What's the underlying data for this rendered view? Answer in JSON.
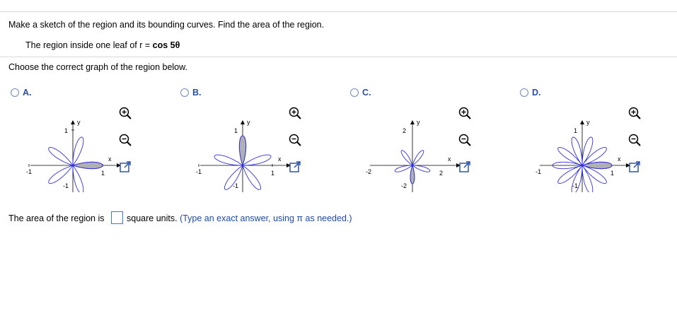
{
  "question": {
    "instruction": "Make a sketch of the region and its bounding curves. Find the area of the region.",
    "region_prefix": "The region inside one leaf of r = ",
    "region_formula": "cos 5θ",
    "choose_prompt": "Choose the correct graph of the region below."
  },
  "options": [
    {
      "letter": "A.",
      "x_label": "x",
      "y_label": "y",
      "y_tick_pos": "1",
      "y_tick_neg": "-1",
      "x_tick_neg": "-1",
      "x_tick_pos": "1"
    },
    {
      "letter": "B.",
      "x_label": "x",
      "y_label": "y",
      "y_tick_pos": "1",
      "y_tick_neg": "-1",
      "x_tick_neg": "-1",
      "x_tick_pos": "1"
    },
    {
      "letter": "C.",
      "x_label": "x",
      "y_label": "y",
      "y_tick_pos": "2",
      "y_tick_neg": "-2",
      "x_tick_neg": "-2",
      "x_tick_pos": "2"
    },
    {
      "letter": "D.",
      "x_label": "x",
      "y_label": "y",
      "y_tick_pos": "1",
      "y_tick_neg": "-1",
      "x_tick_neg": "-1",
      "x_tick_pos": "1"
    }
  ],
  "answer": {
    "prefix": "The area of the region is",
    "suffix": "square units.",
    "hint": "(Type an exact answer, using π as needed.)"
  },
  "colors": {
    "curve": "#3030e0",
    "shade": "#b0b0b0",
    "accent": "#2a4fa0"
  },
  "icons": [
    "zoom-in-icon",
    "zoom-out-icon",
    "expand-icon"
  ]
}
